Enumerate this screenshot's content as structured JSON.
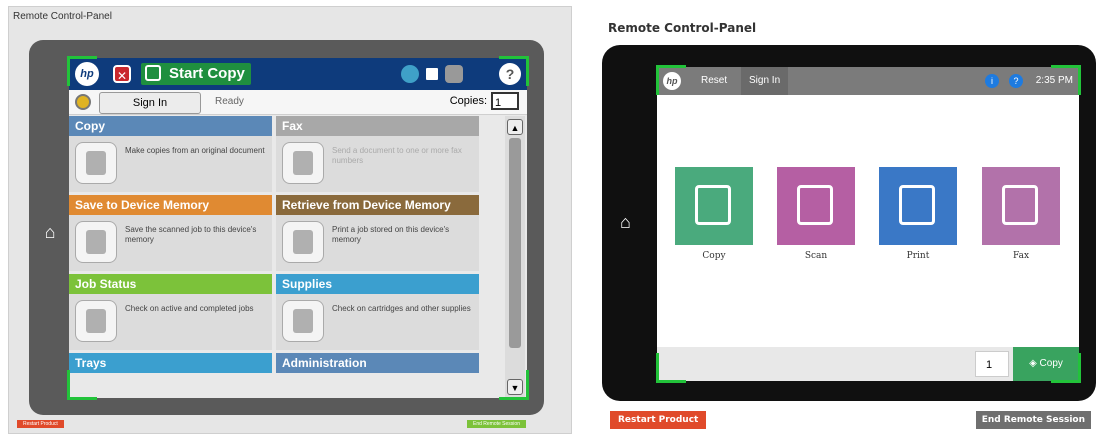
{
  "left_panel": {
    "title": "Remote Control-Panel",
    "topbar": {
      "logo": "hp",
      "start_copy": "Start Copy",
      "help": "?"
    },
    "subbar": {
      "sign_in": "Sign In",
      "status": "Ready",
      "copies_label": "Copies:",
      "copies_value": "1"
    },
    "tiles": [
      {
        "title": "Copy",
        "desc": "Make copies from an original document",
        "color": "#5b88b7"
      },
      {
        "title": "Fax",
        "desc": "Send a document to one or more fax numbers",
        "color": "#a8a8a8"
      },
      {
        "title": "Save to Device Memory",
        "desc": "Save the scanned job to this device's memory",
        "color": "#e08a32"
      },
      {
        "title": "Retrieve from Device Memory",
        "desc": "Print a job stored on this device's memory",
        "color": "#8a6a3c"
      },
      {
        "title": "Job Status",
        "desc": "Check on active and completed jobs",
        "color": "#7cc23a"
      },
      {
        "title": "Supplies",
        "desc": "Check on cartridges and other supplies",
        "color": "#3b9fcf"
      },
      {
        "title": "Trays",
        "desc": "",
        "color": "#3b9fcf"
      },
      {
        "title": "Administration",
        "desc": "",
        "color": "#5b88b7"
      }
    ],
    "restart_button": "Restart Product",
    "end_button": "End Remote Session",
    "colors": {
      "highlight": "#22c33a",
      "topbar": "#0e3b7c"
    }
  },
  "right_panel": {
    "title": "Remote Control-Panel",
    "topbar": {
      "logo": "hp",
      "reset": "Reset",
      "sign_in": "Sign In",
      "time": "2:35 PM"
    },
    "apps": [
      {
        "label": "Copy",
        "color": "#4aaa7d",
        "icon": "copy-icon"
      },
      {
        "label": "Scan",
        "color": "#b55fa3",
        "icon": "scan-icon"
      },
      {
        "label": "Print",
        "color": "#3a78c6",
        "icon": "print-icon"
      },
      {
        "label": "Fax",
        "color": "#b272aa",
        "icon": "fax-icon"
      }
    ],
    "copy_count": "1",
    "copy_button": "Copy",
    "restart_button": "Restart Product",
    "end_button": "End Remote Session"
  }
}
